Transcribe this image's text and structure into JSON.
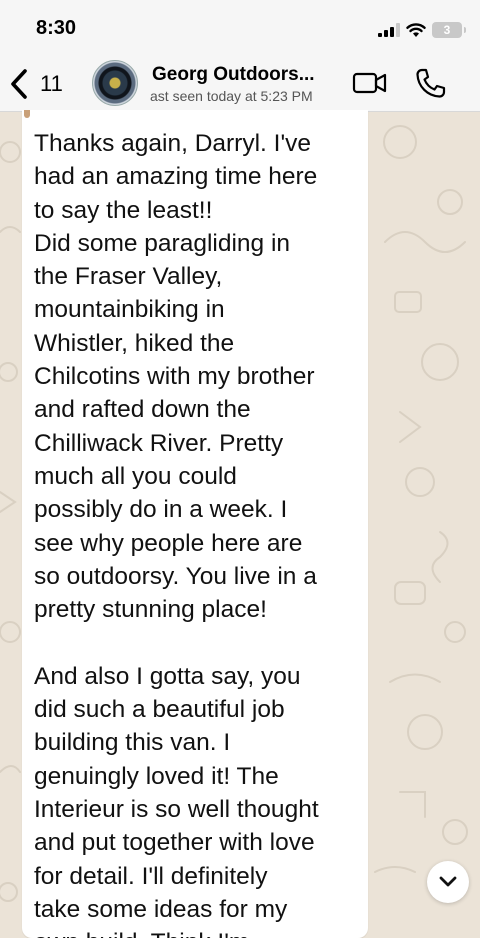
{
  "status_bar": {
    "time": "8:30",
    "battery": "3",
    "icons": [
      "signal-icon",
      "wifi-icon",
      "battery-icon"
    ]
  },
  "header": {
    "back_count": "11",
    "contact_name": "Georg Outdoors...",
    "last_seen": "ast seen today at 5:23 PM",
    "icons": [
      "chevron-left-icon",
      "video-call-icon",
      "phone-icon"
    ]
  },
  "message": {
    "text": "Thanks again, Darryl. I've\nhad an amazing time here\nto say the least!!\nDid some paragliding in\nthe Fraser Valley,\nmountainbiking in\nWhistler, hiked the\nChilcotins with my brother\nand rafted down the\nChilliwack River. Pretty\nmuch all you could\npossibly do in a week. I\nsee why people here are\nso outdoorsy. You live in a\npretty stunning place!\n\nAnd also I gotta say, you\ndid such a beautiful job\nbuilding this van. I\ngenuingly loved it! The\nInterieur is so well thought\nand put together with love\nfor detail. I'll definitely\ntake some ideas for my\nown build. Think I'm"
  },
  "colors": {
    "wallpaper": "#ebe3d7",
    "bubble": "#ffffff",
    "header": "#f6f6f6"
  }
}
